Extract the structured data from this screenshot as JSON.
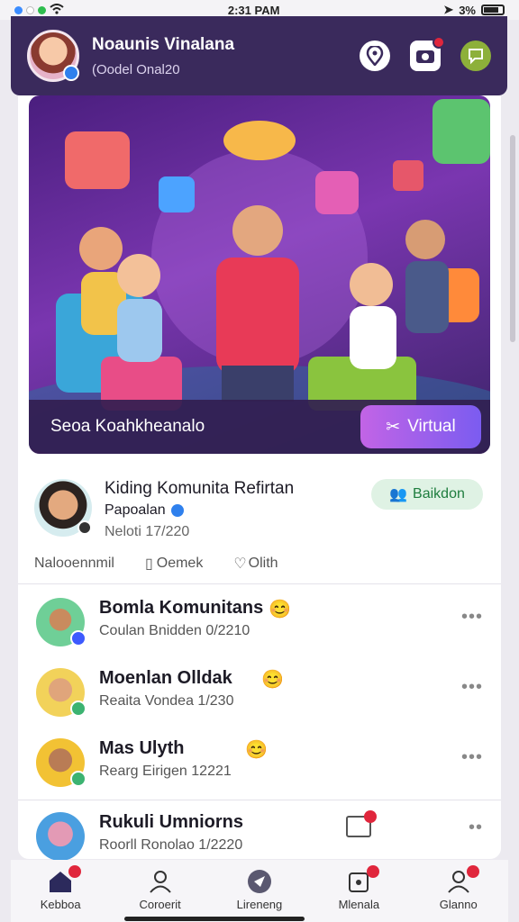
{
  "status": {
    "time": "2:31 PAM",
    "battery": "3%"
  },
  "header": {
    "name": "Noaunis Vinalana",
    "subtitle": "(Oodel Onal20"
  },
  "hero": {
    "title": "Seoa Koahkheanalo",
    "button_label": "Virtual"
  },
  "featured": {
    "title": "Kiding Komunita Refirtan",
    "author": "Papoalan",
    "date": "Neloti 17/220",
    "follow_label": "Baikdon",
    "actions": [
      "Nalooennmil",
      "Oemek",
      "Olith"
    ]
  },
  "list": [
    {
      "title": "Bomla Komunitans",
      "emoji": "😊",
      "subtitle": "Coulan Bnidden 0/2210",
      "more": "•••",
      "accent": "#4a9fe0"
    },
    {
      "title": "Moenlan Olldak",
      "emoji": "😊",
      "subtitle": "Reaita Vondea 1/230",
      "more": "•••",
      "accent": "#3cb371"
    },
    {
      "title": "Mas Ulyth",
      "emoji": "😊",
      "subtitle": "Rearg Eirigen 12221",
      "more": "•••",
      "accent": "#3cb371"
    },
    {
      "title": "Rukuli Umniorns",
      "emoji": "",
      "subtitle": "Roorll Ronolao 1/2220",
      "more": "••",
      "accent": "#4a9fe0"
    }
  ],
  "nav": [
    {
      "label": "Kebboa",
      "icon": "home-icon"
    },
    {
      "label": "Coroerit",
      "icon": "person-icon"
    },
    {
      "label": "Lireneng",
      "icon": "compass-icon"
    },
    {
      "label": "Mlenala",
      "icon": "lock-icon"
    },
    {
      "label": "Glanno",
      "icon": "profile-icon"
    }
  ],
  "colors": {
    "header": "#3a2a5c",
    "accent": "#7b5cf0",
    "follow": "#1e7d3e",
    "badge": "#e0263c"
  }
}
